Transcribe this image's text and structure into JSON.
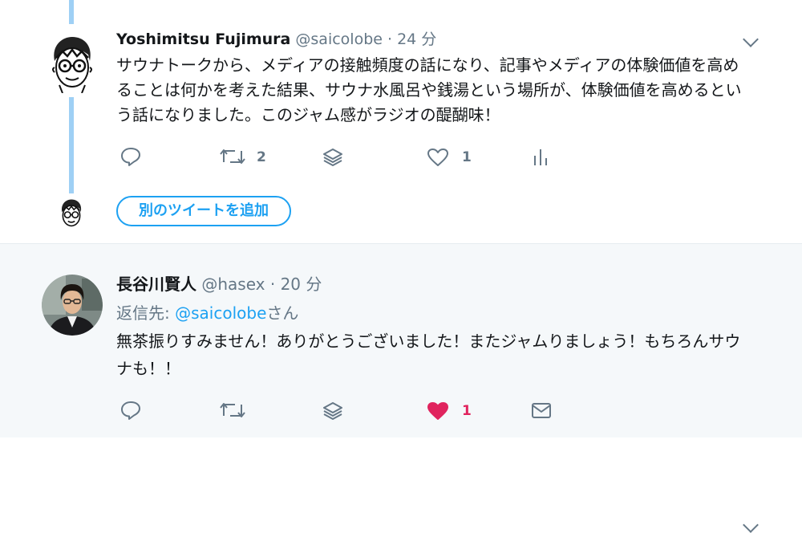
{
  "tweet1": {
    "name": "Yoshimitsu Fujimura",
    "handle": "@saicolobe",
    "dot": "·",
    "time": "24 分",
    "text": "サウナトークから、メディアの接触頻度の話になり、記事やメディアの体験価値を高めることは何かを考えた結果、サウナ水風呂や銭湯という場所が、体験価値を高めるという話になりました。このジャム感がラジオの醍醐味！",
    "actions": {
      "reply_icon": "reply-icon",
      "retweet_icon": "retweet-icon",
      "retweet_count": "2",
      "stack_icon": "stack-icon",
      "like_icon": "heart-outline-icon",
      "like_count": "1",
      "analytics_icon": "analytics-icon"
    }
  },
  "add_tweet_button": "別のツイートを追加",
  "tweet2": {
    "name": "長谷川賢人",
    "handle": "@hasex",
    "dot": "·",
    "time": "20 分",
    "reply_prefix": "返信先: ",
    "reply_mention": "@saicolobe",
    "reply_suffix": "さん",
    "text": "無茶振りすみません！ありがとうございました！またジャムりましょう！もちろんサウナも！！",
    "actions": {
      "reply_icon": "reply-icon",
      "retweet_icon": "retweet-icon",
      "stack_icon": "stack-icon",
      "like_icon": "heart-filled-icon",
      "like_count": "1",
      "dm_icon": "envelope-icon"
    }
  },
  "colors": {
    "accent": "#1da1f2",
    "thread_line": "#9fd0f5",
    "like": "#e0245e",
    "secondary_text": "#657786",
    "reply_bg": "#f5f8fa"
  }
}
